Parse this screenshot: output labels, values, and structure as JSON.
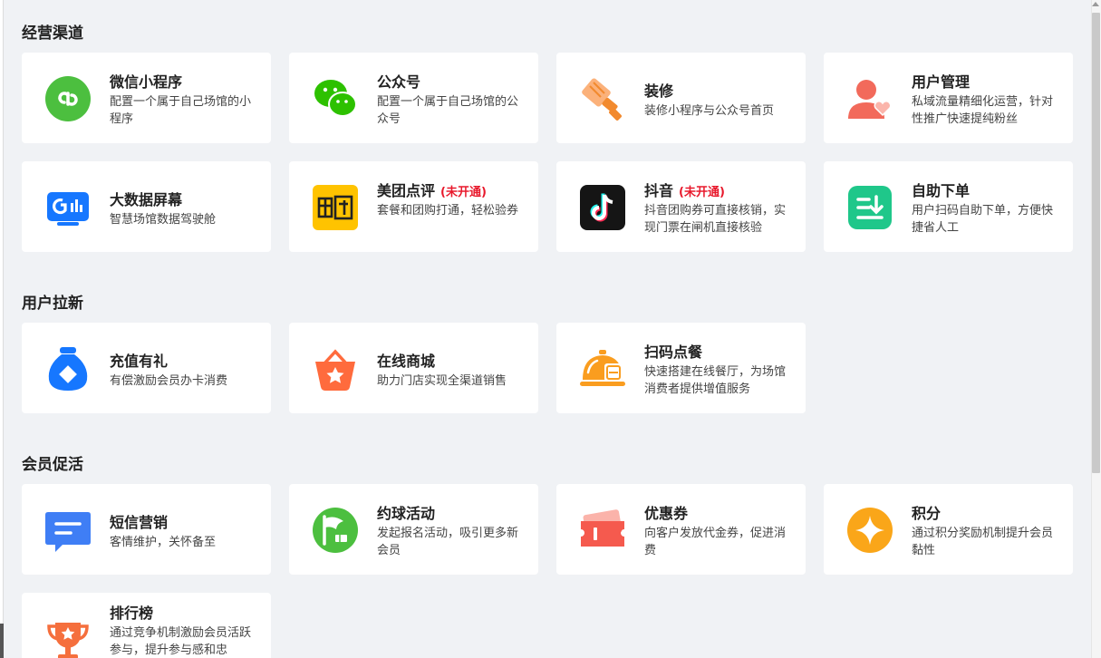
{
  "sections": [
    {
      "title": "经营渠道",
      "cards": [
        {
          "title": "微信小程序",
          "badge": "",
          "desc": "配置一个属于自己场馆的小程序",
          "icon": "mini-program-icon"
        },
        {
          "title": "公众号",
          "badge": "",
          "desc": "配置一个属于自己场馆的公众号",
          "icon": "wechat-icon"
        },
        {
          "title": "装修",
          "badge": "",
          "desc": "装修小程序与公众号首页",
          "icon": "brush-icon"
        },
        {
          "title": "用户管理",
          "badge": "",
          "desc": "私域流量精细化运营，针对性推广快速提纯粉丝",
          "icon": "user-heart-icon"
        },
        {
          "title": "大数据屏幕",
          "badge": "",
          "desc": "智慧场馆数据驾驶舱",
          "icon": "data-screen-icon"
        },
        {
          "title": "美团点评",
          "badge": "(未开通)",
          "desc": "套餐和团购打通，轻松验券",
          "icon": "meituan-icon"
        },
        {
          "title": "抖音",
          "badge": "(未开通)",
          "desc": "抖音团购券可直接核销，实现门票在闸机直接核验",
          "icon": "douyin-icon"
        },
        {
          "title": "自助下单",
          "badge": "",
          "desc": "用户扫码自助下单，方便快捷省人工",
          "icon": "self-order-icon"
        }
      ]
    },
    {
      "title": "用户拉新",
      "cards": [
        {
          "title": "充值有礼",
          "badge": "",
          "desc": "有偿激励会员办卡消费",
          "icon": "money-bag-icon"
        },
        {
          "title": "在线商城",
          "badge": "",
          "desc": "助力门店实现全渠道销售",
          "icon": "shop-basket-icon"
        },
        {
          "title": "扫码点餐",
          "badge": "",
          "desc": "快速搭建在线餐厅，为场馆消费者提供增值服务",
          "icon": "dish-scan-icon"
        }
      ]
    },
    {
      "title": "会员促活",
      "cards": [
        {
          "title": "短信营销",
          "badge": "",
          "desc": "客情维护，关怀备至",
          "icon": "sms-icon"
        },
        {
          "title": "约球活动",
          "badge": "",
          "desc": "发起报名活动，吸引更多新会员",
          "icon": "flag-icon"
        },
        {
          "title": "优惠券",
          "badge": "",
          "desc": "向客户发放代金券，促进消费",
          "icon": "coupon-icon"
        },
        {
          "title": "积分",
          "badge": "",
          "desc": "通过积分奖励机制提升会员黏性",
          "icon": "points-icon"
        },
        {
          "title": "排行榜",
          "badge": "",
          "desc": "通过竞争机制激励会员活跃参与，提升参与感和忠",
          "icon": "trophy-icon"
        }
      ]
    }
  ],
  "colors": {
    "background": "#f0f2f5",
    "card": "#ffffff",
    "badge": "#e8192c"
  }
}
